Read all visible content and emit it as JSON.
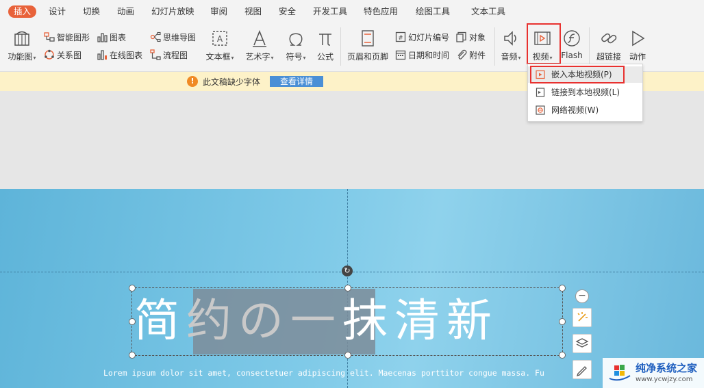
{
  "menu": {
    "tabs": [
      "插入",
      "设计",
      "切换",
      "动画",
      "幻灯片放映",
      "审阅",
      "视图",
      "安全",
      "开发工具",
      "特色应用",
      "绘图工具",
      "文本工具"
    ]
  },
  "ribbon": {
    "function_chart": "功能图",
    "smart_art": "智能图形",
    "chart": "图表",
    "mind_map": "思维导图",
    "relation_chart": "关系图",
    "online_chart": "在线图表",
    "flow_chart": "流程图",
    "text_box": "文本框",
    "word_art": "艺术字",
    "symbol": "符号",
    "formula": "公式",
    "header_footer": "页眉和页脚",
    "slide_number": "幻灯片编号",
    "object": "对象",
    "date_time": "日期和时间",
    "attachment": "附件",
    "audio": "音频",
    "video": "视频",
    "flash": "Flash",
    "hyperlink": "超链接",
    "action": "动作"
  },
  "warning": {
    "text": "此文稿缺少字体",
    "button": "查看详情"
  },
  "video_menu": {
    "items": [
      "嵌入本地视频(P)",
      "链接到本地视频(L)",
      "网络视频(W)"
    ]
  },
  "slide": {
    "title_part1": "简",
    "title_part2": "约の一",
    "title_part3": "抹清新",
    "body": "Lorem ipsum dolor sit amet, consectetuer adipiscing elit. Maecenas porttitor congue massa. Fu"
  },
  "watermark": {
    "name": "纯净系统之家",
    "url": "www.ycwjzy.com"
  },
  "colors": {
    "accent": "#e8623a",
    "highlight_box": "#e8312f",
    "warning_bg": "#fdf2c8",
    "link_button": "#4a8fd6"
  }
}
